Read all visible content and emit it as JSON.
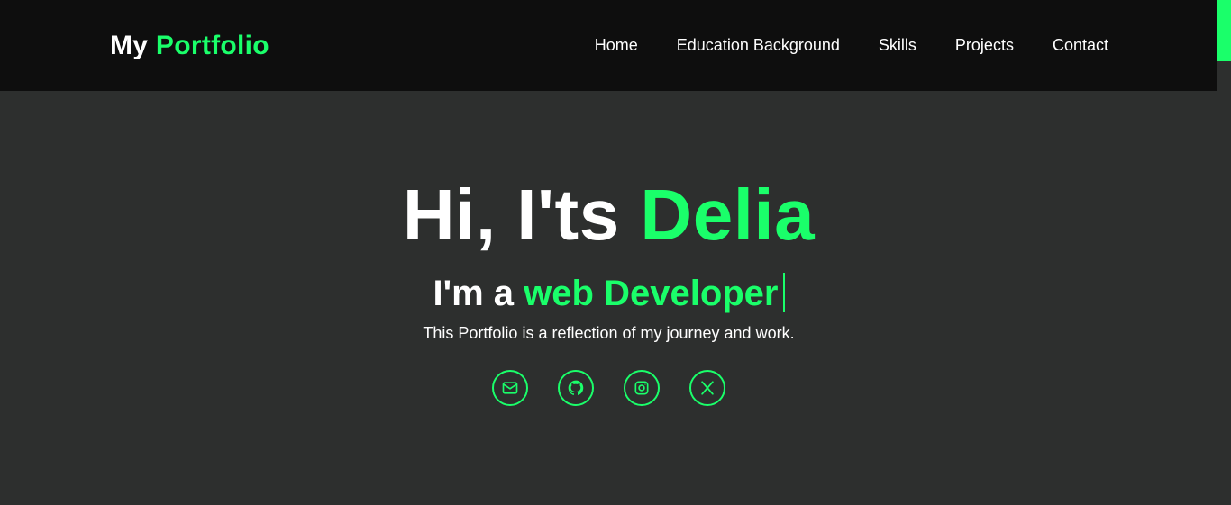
{
  "colors": {
    "accent": "#1aff6a",
    "header_bg": "#0e0e0e",
    "page_bg": "#2d2f2e",
    "text": "#ffffff"
  },
  "header": {
    "logo_prefix": "My",
    "logo_accent": "Portfolio",
    "nav": [
      {
        "label": "Home"
      },
      {
        "label": "Education Background"
      },
      {
        "label": "Skills"
      },
      {
        "label": "Projects"
      },
      {
        "label": "Contact"
      }
    ]
  },
  "hero": {
    "greeting": "Hi, I'ts",
    "name": "Delia",
    "role_prefix": "I'm a",
    "role": "web Developer",
    "description": "This Portfolio is a reflection of my journey and work."
  },
  "socials": [
    {
      "icon": "mail-icon"
    },
    {
      "icon": "github-icon"
    },
    {
      "icon": "instagram-icon"
    },
    {
      "icon": "x-twitter-icon"
    }
  ]
}
